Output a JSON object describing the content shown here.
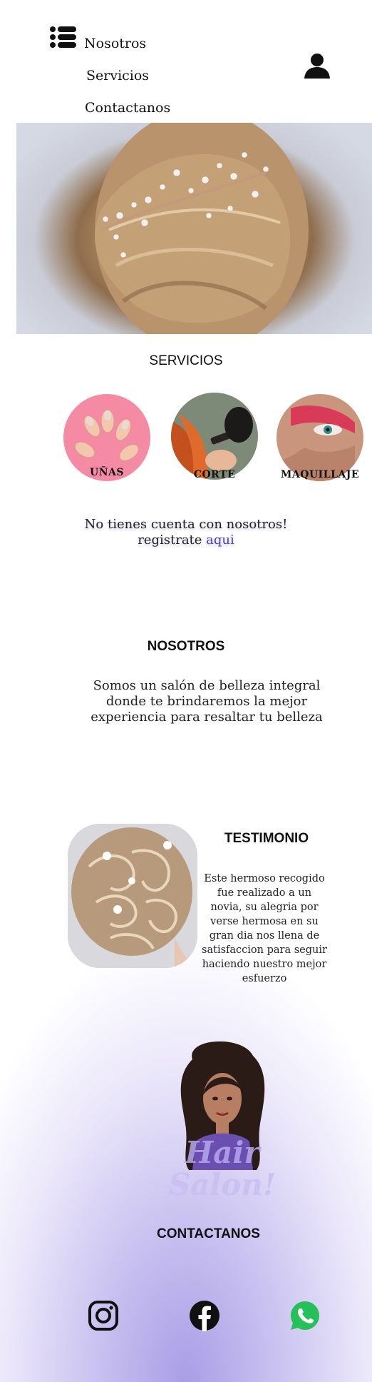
{
  "nav": {
    "menu_icon": "list-icon",
    "links": [
      "Nosotros",
      "Servicios",
      "Contactanos"
    ],
    "user_icon": "user-icon"
  },
  "hero": {
    "image": "bridal-hair-accessory-photo"
  },
  "services": {
    "title": "SERVICIOS",
    "items": [
      {
        "label": "UÑAS",
        "image": "nails-photo"
      },
      {
        "label": "CORTE",
        "image": "haircut-photo"
      },
      {
        "label": "MAQUILLAJE",
        "image": "makeup-photo"
      }
    ]
  },
  "register": {
    "line1": "No tienes cuenta con nosotros!",
    "line2": "registrate",
    "link": "aqui"
  },
  "about": {
    "title": "NOSOTROS",
    "text": "Somos un salón de belleza integral donde te brindaremos la mejor experiencia para resaltar tu belleza"
  },
  "testimonial": {
    "title": "TESTIMONIO",
    "text": "Este hermoso recogido fue realizado a un novia, su alegria por verse hermosa en su gran dia nos llena de satisfaccion para seguir haciendo nuestro mejor esfuerzo"
  },
  "logo": {
    "line1": "Hair",
    "line2": "Salon!"
  },
  "contact": {
    "title": "CONTACTANOS",
    "social": [
      "instagram-icon",
      "facebook-icon",
      "whatsapp-icon"
    ]
  },
  "colors": {
    "accent": "#4a3fcf",
    "gradient": "#a99ee6"
  }
}
